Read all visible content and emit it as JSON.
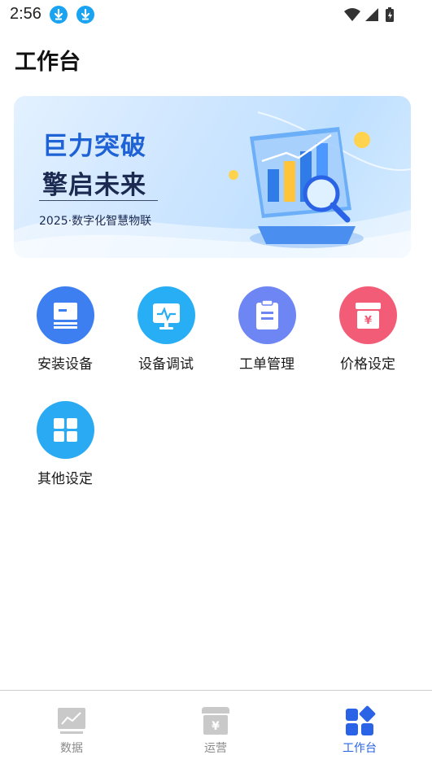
{
  "status_bar": {
    "time": "2:56"
  },
  "page": {
    "title": "工作台"
  },
  "banner": {
    "headline": "巨力突破",
    "subheadline": "擎启未来",
    "tagline": "2025·数字化智慧物联"
  },
  "grid": [
    {
      "label": "安装设备",
      "icon": "install-device-icon",
      "color": "#3d7ff0"
    },
    {
      "label": "设备调试",
      "icon": "device-debug-icon",
      "color": "#28aef5"
    },
    {
      "label": "工单管理",
      "icon": "work-order-icon",
      "color": "#6d86f3"
    },
    {
      "label": "价格设定",
      "icon": "price-setting-icon",
      "color": "#f25c76"
    },
    {
      "label": "其他设定",
      "icon": "other-settings-icon",
      "color": "#2aaaf3"
    }
  ],
  "bottom_nav": [
    {
      "label": "数据",
      "icon": "chart-icon",
      "active": false
    },
    {
      "label": "运营",
      "icon": "store-icon",
      "active": false
    },
    {
      "label": "工作台",
      "icon": "workbench-icon",
      "active": true
    }
  ],
  "colors": {
    "accent": "#2a63e6",
    "inactive": "#8a8a8a"
  }
}
